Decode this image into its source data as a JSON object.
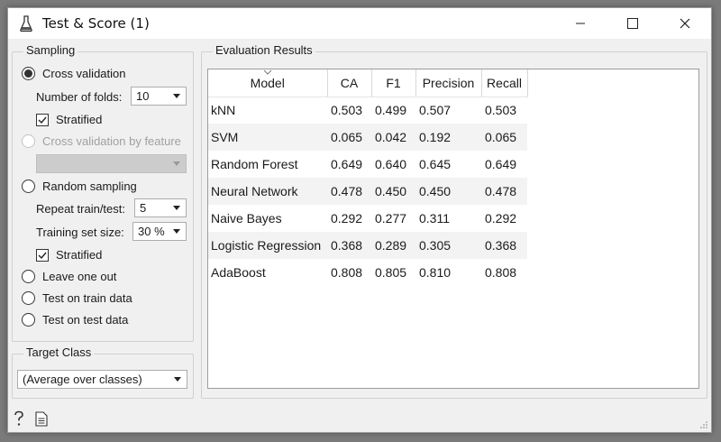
{
  "window": {
    "title": "Test & Score (1)",
    "icons": {
      "app": "flask-icon",
      "minimize": "minimize-icon",
      "maximize": "maximize-icon",
      "close": "close-icon"
    }
  },
  "sampling": {
    "title": "Sampling",
    "cross_validation": {
      "label": "Cross validation",
      "selected": true
    },
    "folds": {
      "label": "Number of folds:",
      "value": "10"
    },
    "stratified_cv": {
      "label": "Stratified",
      "checked": true
    },
    "cv_by_feature": {
      "label": "Cross validation by feature",
      "enabled": false,
      "value": ""
    },
    "random_sampling": {
      "label": "Random sampling",
      "selected": false
    },
    "repeat": {
      "label": "Repeat train/test:",
      "value": "5"
    },
    "train_size": {
      "label": "Training set size:",
      "value": "30 %"
    },
    "stratified_rs": {
      "label": "Stratified",
      "checked": true
    },
    "leave_one_out": {
      "label": "Leave one out"
    },
    "test_on_train": {
      "label": "Test on train data"
    },
    "test_on_test": {
      "label": "Test on test data"
    }
  },
  "target_class": {
    "title": "Target Class",
    "value": "(Average over classes)"
  },
  "results": {
    "title": "Evaluation Results",
    "columns": [
      "Model",
      "CA",
      "F1",
      "Precision",
      "Recall"
    ],
    "rows": [
      [
        "kNN",
        "0.503",
        "0.499",
        "0.507",
        "0.503"
      ],
      [
        "SVM",
        "0.065",
        "0.042",
        "0.192",
        "0.065"
      ],
      [
        "Random Forest",
        "0.649",
        "0.640",
        "0.645",
        "0.649"
      ],
      [
        "Neural Network",
        "0.478",
        "0.450",
        "0.450",
        "0.478"
      ],
      [
        "Naive Bayes",
        "0.292",
        "0.277",
        "0.311",
        "0.292"
      ],
      [
        "Logistic Regression",
        "0.368",
        "0.289",
        "0.305",
        "0.368"
      ],
      [
        "AdaBoost",
        "0.808",
        "0.805",
        "0.810",
        "0.808"
      ]
    ]
  },
  "footer": {
    "icons": [
      "help-icon",
      "report-icon"
    ]
  }
}
